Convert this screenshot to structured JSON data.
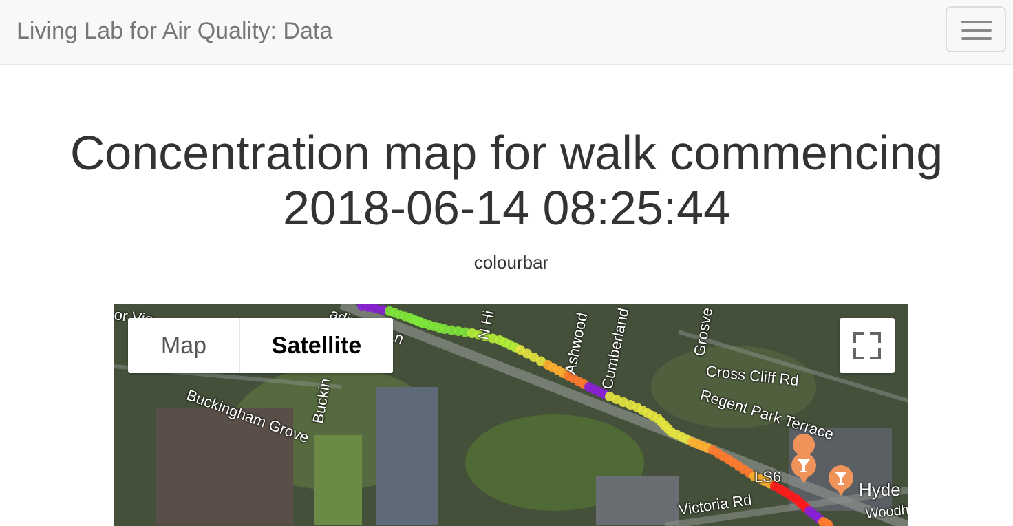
{
  "navbar": {
    "brand": "Living Lab for Air Quality: Data",
    "menu_icon": "hamburger-icon"
  },
  "page": {
    "title_line1": "Concentration map for walk commencing",
    "title_line2": "2018-06-14 08:25:44",
    "colourbar_label": "colourbar"
  },
  "map": {
    "type_controls": {
      "map_label": "Map",
      "satellite_label": "Satellite",
      "selected": "Satellite"
    },
    "fullscreen_icon": "fullscreen-icon",
    "street_labels": {
      "buckingham_grove": "Buckingham Grove",
      "buckingham_partial": "Buckin",
      "cross_cliff": "Cross Cliff Rd",
      "regent_park": "Regent Park Terrace",
      "victoria": "Victoria Rd",
      "ashwood": "Ashwood",
      "cumberland": "Cumberland",
      "grosvenor": "Grosve",
      "n_hill": "N Hi",
      "headingley_ln": "adingley Ln",
      "moor_view": "or Vie",
      "postcode": "LS6",
      "hyde": "Hyde",
      "woodhouse": "Woodh"
    },
    "poi_icon": "cocktail-bar-icon",
    "track_colors": [
      "#8a1fd6",
      "#ff1a1a",
      "#ff7b2e",
      "#ffb030",
      "#e6e640",
      "#b5ef3a",
      "#7ee63a"
    ]
  }
}
